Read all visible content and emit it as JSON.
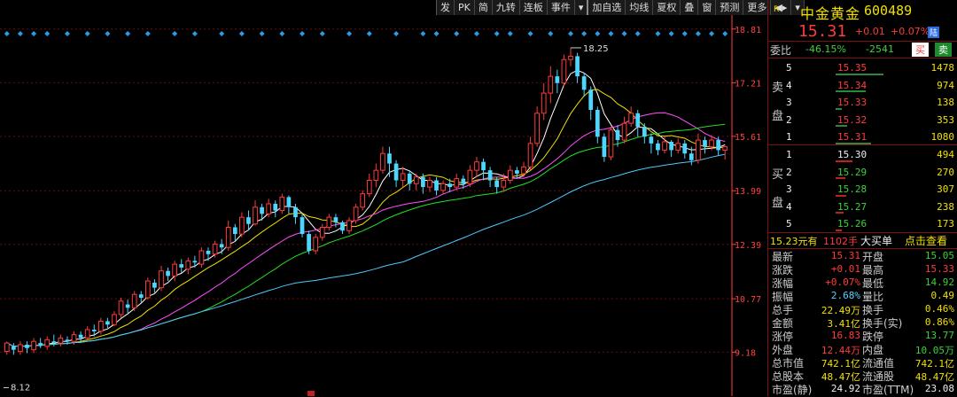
{
  "toolbar": [
    "发",
    "PK",
    "简",
    "九转",
    "连板",
    "事件",
    "▾",
    "加自选",
    "均线",
    "夏权",
    "叠",
    "窗",
    "预测",
    "更多",
    "◀▸",
    "▾"
  ],
  "stock": {
    "r_mark": "R",
    "name": "中金黄金",
    "code": "600489",
    "price": "15.31",
    "change": "+0.01",
    "pct": "+0.07%",
    "badge": "陆"
  },
  "weibi": {
    "label": "委比",
    "ratio": "-46.15%",
    "diff": "-2541",
    "buy": "买",
    "sell": "卖"
  },
  "sell_label": [
    "卖",
    "盘"
  ],
  "buy_label": [
    "买",
    "盘"
  ],
  "asks": [
    {
      "level": "5",
      "price": "15.35",
      "vol": "1478",
      "bar": 0.4
    },
    {
      "level": "4",
      "price": "15.34",
      "vol": "974",
      "bar": 0.25
    },
    {
      "level": "3",
      "price": "15.33",
      "vol": "138",
      "bar": 0.05
    },
    {
      "level": "2",
      "price": "15.32",
      "vol": "353",
      "bar": 0.1
    },
    {
      "level": "1",
      "price": "15.31",
      "vol": "1080",
      "bar": 0.3
    }
  ],
  "bids": [
    {
      "level": "1",
      "price": "15.30",
      "vol": "494",
      "bar": 0.14
    },
    {
      "level": "2",
      "price": "15.29",
      "vol": "270",
      "bar": 0.08
    },
    {
      "level": "3",
      "price": "15.28",
      "vol": "307",
      "bar": 0.09
    },
    {
      "level": "4",
      "price": "15.27",
      "vol": "238",
      "bar": 0.07
    },
    {
      "level": "5",
      "price": "15.26",
      "vol": "173",
      "bar": 0.05
    }
  ],
  "big_order": {
    "price": "15.23元有",
    "vol": "1102手",
    "label": "大买单",
    "action": "点击查看"
  },
  "quote": [
    {
      "l": "最新",
      "v": "15.31",
      "vc": "red",
      "l2": "开盘",
      "v2": "15.05",
      "v2c": "green"
    },
    {
      "l": "涨跌",
      "v": "+0.01",
      "vc": "red",
      "l2": "最高",
      "v2": "15.33",
      "v2c": "red"
    },
    {
      "l": "涨幅",
      "v": "+0.07%",
      "vc": "red",
      "l2": "最低",
      "v2": "14.92",
      "v2c": "green"
    },
    {
      "l": "振幅",
      "v": "2.68%",
      "vc": "cyan",
      "l2": "量比",
      "v2": "0.49",
      "v2c": "yellow"
    },
    {
      "l": "总手",
      "v": "22.49万",
      "vc": "yellow",
      "l2": "换手",
      "v2": "0.46%",
      "v2c": "yellow"
    },
    {
      "l": "金额",
      "v": "3.41亿",
      "vc": "yellow",
      "l2": "换手(实)",
      "v2": "0.86%",
      "v2c": "yellow"
    },
    {
      "l": "涨停",
      "v": "16.83",
      "vc": "red",
      "l2": "跌停",
      "v2": "13.77",
      "v2c": "green"
    },
    {
      "l": "外盘",
      "v": "12.44万",
      "vc": "red",
      "l2": "内盘",
      "v2": "10.05万",
      "v2c": "green"
    },
    {
      "l": "总市值",
      "v": "742.1亿",
      "vc": "yellow",
      "l2": "流通值",
      "v2": "742.1亿",
      "v2c": "yellow"
    },
    {
      "l": "总股本",
      "v": "48.47亿",
      "vc": "yellow",
      "l2": "流通股",
      "v2": "48.47亿",
      "v2c": "yellow"
    },
    {
      "l": "市盈(静)",
      "v": "24.92",
      "vc": "white",
      "l2": "市盈(TTM)",
      "v2": "23.08",
      "v2c": "white"
    }
  ],
  "colors": {
    "up": "#ff3b3b",
    "down": "#4fd6ff",
    "grid": "#6b0a0a",
    "axis": "#ff4040",
    "ma5": "#ffffff",
    "ma10": "#f0e000",
    "ma20": "#ff50ff",
    "ma30": "#22e022",
    "ma60": "#4fc8ff"
  },
  "chart_data": {
    "type": "candlestick",
    "y_ticks": [
      "18.81",
      "17.21",
      "15.61",
      "13.99",
      "12.39",
      "10.77",
      "9.18"
    ],
    "ylim": [
      8.0,
      19.2
    ],
    "high_label": "18.25",
    "low_label": "8.12",
    "candles": [
      [
        9.2,
        9.45,
        9.1,
        9.5
      ],
      [
        9.35,
        9.25,
        9.1,
        9.45
      ],
      [
        9.2,
        9.4,
        9.1,
        9.5
      ],
      [
        9.4,
        9.3,
        9.15,
        9.5
      ],
      [
        9.25,
        9.5,
        9.15,
        9.6
      ],
      [
        9.45,
        9.4,
        9.3,
        9.6
      ],
      [
        9.35,
        9.55,
        9.25,
        9.65
      ],
      [
        9.5,
        9.45,
        9.35,
        9.7
      ],
      [
        9.45,
        9.6,
        9.35,
        9.7
      ],
      [
        9.55,
        9.5,
        9.4,
        9.65
      ],
      [
        9.5,
        9.7,
        9.4,
        9.8
      ],
      [
        9.7,
        9.6,
        9.5,
        9.8
      ],
      [
        9.6,
        9.85,
        9.5,
        9.95
      ],
      [
        9.85,
        9.8,
        9.65,
        10.0
      ],
      [
        9.8,
        10.1,
        9.7,
        10.2
      ],
      [
        10.1,
        10.0,
        9.9,
        10.2
      ],
      [
        10.0,
        10.3,
        9.95,
        10.4
      ],
      [
        10.3,
        10.7,
        10.2,
        10.8
      ],
      [
        10.6,
        10.5,
        10.35,
        10.75
      ],
      [
        10.5,
        10.9,
        10.4,
        11.0
      ],
      [
        10.9,
        10.8,
        10.65,
        11.0
      ],
      [
        10.8,
        11.3,
        10.75,
        11.4
      ],
      [
        11.25,
        11.1,
        10.95,
        11.35
      ],
      [
        11.1,
        11.6,
        11.0,
        11.75
      ],
      [
        11.6,
        11.45,
        11.3,
        11.7
      ],
      [
        11.45,
        11.8,
        11.3,
        11.9
      ],
      [
        11.8,
        11.7,
        11.55,
        11.95
      ],
      [
        11.65,
        11.9,
        11.5,
        12.0
      ],
      [
        11.9,
        11.85,
        11.7,
        12.05
      ],
      [
        11.8,
        12.2,
        11.7,
        12.3
      ],
      [
        12.2,
        12.1,
        11.9,
        12.3
      ],
      [
        12.1,
        12.4,
        12.0,
        12.5
      ],
      [
        12.4,
        12.3,
        12.1,
        12.55
      ],
      [
        12.3,
        12.9,
        12.2,
        13.1
      ],
      [
        12.9,
        12.7,
        12.5,
        13.0
      ],
      [
        12.7,
        13.2,
        12.6,
        13.35
      ],
      [
        13.2,
        13.0,
        12.8,
        13.4
      ],
      [
        13.0,
        13.5,
        12.95,
        13.7
      ],
      [
        13.5,
        13.3,
        13.1,
        13.6
      ],
      [
        13.3,
        13.6,
        13.2,
        13.75
      ],
      [
        13.6,
        13.4,
        13.2,
        13.7
      ],
      [
        13.4,
        13.8,
        13.3,
        13.9
      ],
      [
        13.8,
        13.5,
        13.3,
        13.85
      ],
      [
        13.5,
        13.2,
        13.0,
        13.6
      ],
      [
        13.2,
        12.7,
        12.6,
        13.3
      ],
      [
        12.7,
        12.2,
        12.1,
        12.8
      ],
      [
        12.2,
        12.6,
        12.1,
        12.7
      ],
      [
        12.6,
        12.9,
        12.5,
        13.0
      ],
      [
        12.9,
        13.2,
        12.8,
        13.3
      ],
      [
        13.2,
        13.05,
        12.9,
        13.3
      ],
      [
        13.05,
        12.8,
        12.7,
        13.1
      ],
      [
        12.8,
        13.1,
        12.7,
        13.2
      ],
      [
        13.1,
        13.5,
        13.0,
        13.6
      ],
      [
        13.5,
        13.9,
        13.4,
        14.0
      ],
      [
        13.9,
        14.3,
        13.8,
        14.5
      ],
      [
        14.3,
        14.6,
        14.1,
        14.8
      ],
      [
        14.6,
        15.1,
        14.5,
        15.3
      ],
      [
        15.1,
        14.8,
        14.4,
        15.3
      ],
      [
        14.8,
        14.3,
        14.1,
        14.9
      ],
      [
        14.3,
        14.5,
        14.1,
        14.7
      ],
      [
        14.5,
        14.2,
        14.0,
        14.6
      ],
      [
        14.2,
        14.4,
        14.0,
        14.5
      ],
      [
        14.4,
        14.1,
        13.9,
        14.5
      ],
      [
        14.1,
        14.3,
        13.95,
        14.4
      ],
      [
        14.3,
        14.0,
        13.85,
        14.4
      ],
      [
        14.0,
        14.2,
        13.9,
        14.3
      ],
      [
        14.2,
        14.1,
        13.95,
        14.35
      ],
      [
        14.1,
        14.35,
        14.0,
        14.5
      ],
      [
        14.35,
        14.2,
        14.05,
        14.45
      ],
      [
        14.2,
        14.6,
        14.1,
        14.75
      ],
      [
        14.6,
        14.85,
        14.4,
        15.0
      ],
      [
        14.85,
        14.6,
        14.3,
        14.95
      ],
      [
        14.6,
        14.3,
        14.1,
        14.7
      ],
      [
        14.3,
        14.1,
        13.9,
        14.4
      ],
      [
        14.1,
        14.3,
        13.95,
        14.5
      ],
      [
        14.3,
        14.6,
        14.2,
        14.75
      ],
      [
        14.6,
        14.5,
        14.35,
        14.7
      ],
      [
        14.5,
        14.7,
        14.4,
        14.85
      ],
      [
        14.7,
        15.4,
        14.6,
        15.6
      ],
      [
        15.4,
        16.3,
        15.3,
        16.5
      ],
      [
        16.3,
        16.9,
        16.1,
        17.2
      ],
      [
        16.9,
        17.4,
        16.6,
        17.7
      ],
      [
        17.4,
        17.2,
        16.9,
        17.6
      ],
      [
        17.2,
        17.9,
        17.1,
        18.05
      ],
      [
        17.9,
        18.0,
        17.7,
        18.25
      ],
      [
        18.0,
        17.4,
        17.2,
        18.1
      ],
      [
        17.4,
        17.0,
        16.8,
        17.5
      ],
      [
        17.0,
        16.4,
        16.1,
        17.1
      ],
      [
        16.4,
        15.6,
        15.4,
        16.5
      ],
      [
        15.6,
        15.0,
        14.85,
        15.7
      ],
      [
        15.0,
        15.8,
        14.9,
        15.9
      ],
      [
        15.8,
        15.5,
        15.3,
        15.95
      ],
      [
        15.5,
        16.0,
        15.4,
        16.2
      ],
      [
        16.0,
        16.3,
        15.9,
        16.5
      ],
      [
        16.3,
        15.9,
        15.6,
        16.4
      ],
      [
        15.9,
        15.6,
        15.4,
        16.0
      ],
      [
        15.6,
        15.4,
        15.1,
        15.7
      ],
      [
        15.4,
        15.2,
        15.05,
        15.5
      ],
      [
        15.2,
        15.45,
        15.1,
        15.6
      ],
      [
        15.45,
        15.2,
        15.0,
        15.5
      ],
      [
        15.2,
        15.4,
        15.1,
        15.55
      ],
      [
        15.4,
        15.1,
        14.95,
        15.5
      ],
      [
        15.1,
        14.9,
        14.75,
        15.3
      ],
      [
        14.9,
        15.5,
        14.8,
        15.7
      ],
      [
        15.5,
        15.3,
        15.1,
        15.6
      ],
      [
        15.3,
        15.5,
        15.2,
        15.65
      ],
      [
        15.5,
        15.2,
        15.05,
        15.6
      ],
      [
        15.2,
        15.3,
        14.92,
        15.33
      ]
    ]
  }
}
